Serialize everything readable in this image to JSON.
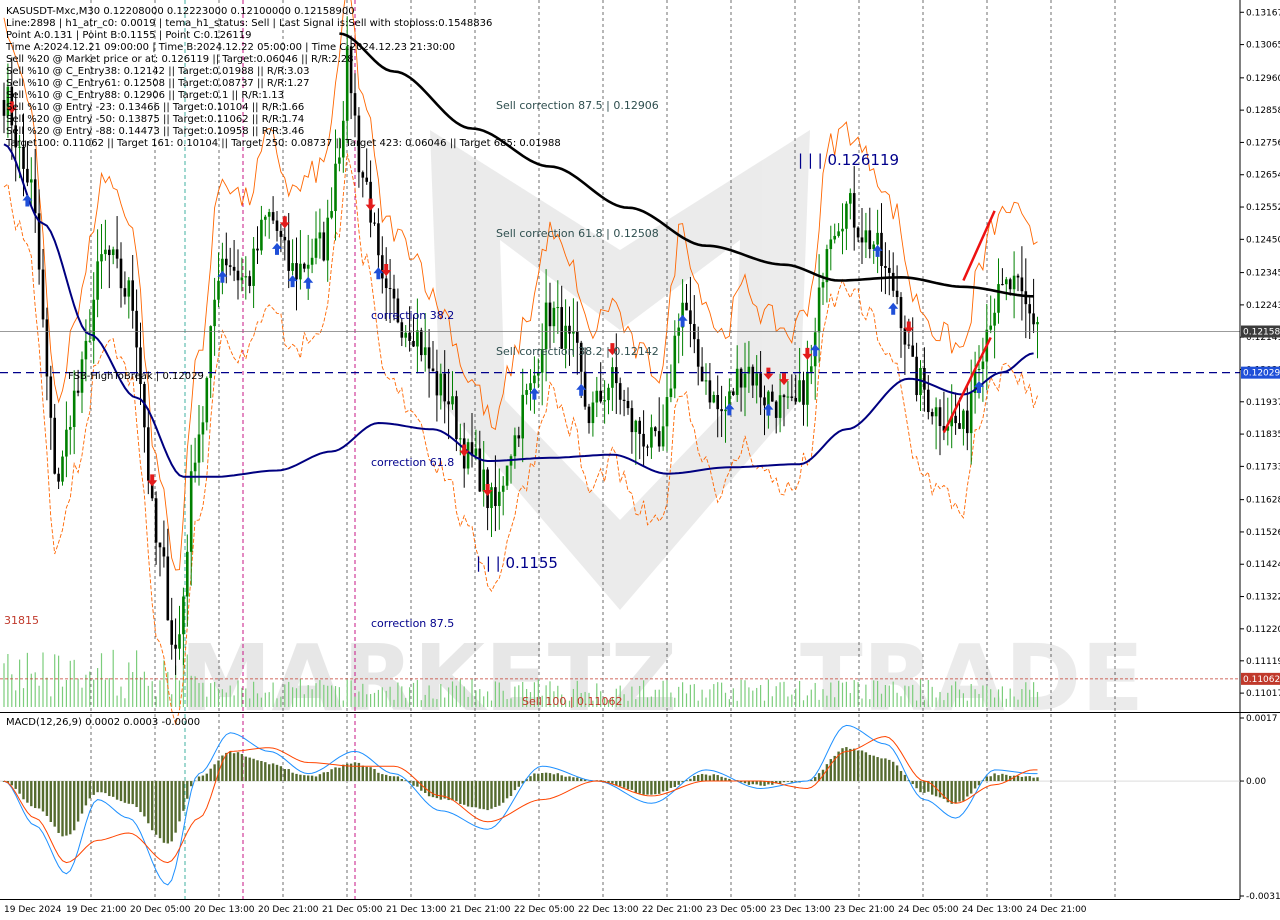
{
  "header": {
    "symbol_line": "KASUSDT-Mxc,M30  0.12208000 0.12223000 0.12100000 0.12158900",
    "info_lines": [
      "Line:2898 | h1_atr_c0: 0.0019 | tema_h1_status: Sell | Last Signal is:Sell with stoploss:0.1548836",
      "Point A:0.131 | Point B:0.1155 | Point C:0.126119",
      "Time A:2024.12.21 09:00:00 | Time B:2024.12.22 05:00:00 | Time C:2024.12.23 21:30:00",
      "Sell %20 @ Market price or at: 0.126119 || Target:0.06046 || R/R:2.28",
      "Sell %10 @ C_Entry38: 0.12142 || Target:0.01988 || R/R:3.03",
      "Sell %10 @ C_Entry61: 0.12508 || Target:0.08737 || R/R:1.27",
      "Sell %10 @ C_Entry88: 0.12906 || Target:0.1 || R/R:1.13",
      "Sell %10 @ Entry -23: 0.13466 || Target:0.10104 || R/R:1.66",
      "Sell %20 @ Entry -50: 0.13875 || Target:0.11062 || R/R:1.74",
      "Sell %20 @ Entry -88: 0.14473 || Target:0.10958 || R/R:3.46",
      "Target100: 0.11062 || Target 161: 0.10104 || Target 250: 0.08737 || Target 423: 0.06046 || Target 685: 0.01988"
    ]
  },
  "annotations": {
    "sell_correction_875": "Sell correction 87.5 | 0.12906",
    "sell_correction_618": "Sell correction 61.8 | 0.12508",
    "sell_correction_382": "Sell correction 38.2 | 0.12142",
    "correction_382": "correction 38.2",
    "correction_618": "correction 61.8",
    "correction_875": "correction 87.5",
    "point_c_label": "| | | 0.126119",
    "point_b_label": "| | | 0.1155",
    "sell_100": "Sell 100 | 0.11062",
    "fsb_label": "FSB-HighToBreak | 0.12029",
    "left_value": "31815"
  },
  "macd": {
    "label": "MACD(12,26,9) 0.0002 0.0003 -0.0000",
    "ticks": [
      {
        "value": 0.0017,
        "label": "0.0017"
      },
      {
        "value": 0.0,
        "label": "0.00"
      },
      {
        "value": -0.0031,
        "label": "-0.0031"
      }
    ]
  },
  "price_axis": {
    "min": 0.1097,
    "max": 0.1319,
    "ticks": [
      "0.13167",
      "0.13065",
      "0.12960",
      "0.12858",
      "0.12756",
      "0.12654",
      "0.12552",
      "0.12450",
      "0.12345",
      "0.12243",
      "0.12141",
      "0.12039",
      "0.11937",
      "0.11835",
      "0.11733",
      "0.11628",
      "0.11526",
      "0.11424",
      "0.11322",
      "0.11220",
      "0.11119",
      "0.11017"
    ],
    "tags": [
      {
        "value": 0.121589,
        "label": "0.12158",
        "color": "#3c3c3c"
      },
      {
        "value": 0.12029,
        "label": "0.12029",
        "color": "#1f4fd8"
      },
      {
        "value": 0.11062,
        "label": "0.11062",
        "color": "#c0392b"
      }
    ]
  },
  "time_axis": {
    "labels": [
      "19 Dec 2024",
      "19 Dec 21:00",
      "20 Dec 05:00",
      "20 Dec 13:00",
      "20 Dec 21:00",
      "21 Dec 05:00",
      "21 Dec 13:00",
      "21 Dec 21:00",
      "22 Dec 05:00",
      "22 Dec 13:00",
      "22 Dec 21:00",
      "23 Dec 05:00",
      "23 Dec 13:00",
      "23 Dec 21:00",
      "24 Dec 05:00",
      "24 Dec 13:00",
      "24 Dec 21:00"
    ]
  },
  "watermark": {
    "word1": "MARKETZ",
    "word2": "TRADE"
  },
  "colors": {
    "bull": "#008000",
    "bear": "#000000",
    "ma_long": "#000000",
    "ma_short": "#000080",
    "envelope": "#ff6600",
    "fsb_line": "#00008b",
    "sell_line": "#c0392b",
    "macd_hist": "#556b2f",
    "macd_line": "#1e90ff",
    "signal_line": "#ff4500",
    "volume": "#7ccd7c",
    "buy_arrow": "#1f4fd8",
    "sell_arrow": "#e31b1b"
  },
  "chart_data": {
    "type": "candlestick",
    "timeframe": "M30",
    "symbol": "KASUSDT-Mxc",
    "ylim": [
      0.1097,
      0.1319
    ],
    "macd_ylim": [
      -0.0031,
      0.0017
    ],
    "anchors": [
      {
        "i": 0,
        "p": 0.129
      },
      {
        "i": 6,
        "p": 0.1265
      },
      {
        "i": 14,
        "p": 0.117
      },
      {
        "i": 18,
        "p": 0.1195
      },
      {
        "i": 26,
        "p": 0.124
      },
      {
        "i": 32,
        "p": 0.1228
      },
      {
        "i": 40,
        "p": 0.1145
      },
      {
        "i": 44,
        "p": 0.1115
      },
      {
        "i": 50,
        "p": 0.1185
      },
      {
        "i": 56,
        "p": 0.124
      },
      {
        "i": 62,
        "p": 0.1232
      },
      {
        "i": 68,
        "p": 0.1252
      },
      {
        "i": 74,
        "p": 0.1235
      },
      {
        "i": 82,
        "p": 0.1243
      },
      {
        "i": 86,
        "p": 0.1275
      },
      {
        "i": 88,
        "p": 0.13
      },
      {
        "i": 92,
        "p": 0.1265
      },
      {
        "i": 98,
        "p": 0.1225
      },
      {
        "i": 104,
        "p": 0.1218
      },
      {
        "i": 112,
        "p": 0.1198
      },
      {
        "i": 120,
        "p": 0.1175
      },
      {
        "i": 126,
        "p": 0.116
      },
      {
        "i": 130,
        "p": 0.118
      },
      {
        "i": 134,
        "p": 0.1195
      },
      {
        "i": 140,
        "p": 0.1222
      },
      {
        "i": 146,
        "p": 0.121
      },
      {
        "i": 150,
        "p": 0.119
      },
      {
        "i": 156,
        "p": 0.12
      },
      {
        "i": 162,
        "p": 0.1185
      },
      {
        "i": 168,
        "p": 0.1178
      },
      {
        "i": 174,
        "p": 0.1225
      },
      {
        "i": 178,
        "p": 0.1205
      },
      {
        "i": 184,
        "p": 0.119
      },
      {
        "i": 190,
        "p": 0.1205
      },
      {
        "i": 196,
        "p": 0.1195
      },
      {
        "i": 202,
        "p": 0.119
      },
      {
        "i": 206,
        "p": 0.12
      },
      {
        "i": 212,
        "p": 0.125
      },
      {
        "i": 216,
        "p": 0.1255
      },
      {
        "i": 222,
        "p": 0.1245
      },
      {
        "i": 228,
        "p": 0.123
      },
      {
        "i": 234,
        "p": 0.12
      },
      {
        "i": 240,
        "p": 0.119
      },
      {
        "i": 246,
        "p": 0.1185
      },
      {
        "i": 250,
        "p": 0.121
      },
      {
        "i": 254,
        "p": 0.1225
      },
      {
        "i": 258,
        "p": 0.123
      },
      {
        "i": 264,
        "p": 0.122
      }
    ],
    "macd_anchors": [
      {
        "i": 0,
        "m": 0.0,
        "s": 0.0
      },
      {
        "i": 8,
        "m": -0.0012,
        "s": -0.001
      },
      {
        "i": 16,
        "m": -0.0025,
        "s": -0.0022
      },
      {
        "i": 24,
        "m": -0.0005,
        "s": -0.0016
      },
      {
        "i": 32,
        "m": -0.001,
        "s": -0.0014
      },
      {
        "i": 42,
        "m": -0.0028,
        "s": -0.0022
      },
      {
        "i": 50,
        "m": 0.0002,
        "s": -0.001
      },
      {
        "i": 58,
        "m": 0.0013,
        "s": 0.0008
      },
      {
        "i": 68,
        "m": 0.0008,
        "s": 0.0009
      },
      {
        "i": 78,
        "m": 0.0002,
        "s": 0.0005
      },
      {
        "i": 90,
        "m": 0.0008,
        "s": 0.0004
      },
      {
        "i": 100,
        "m": 0.0002,
        "s": 0.0004
      },
      {
        "i": 112,
        "m": -0.0008,
        "s": -0.0004
      },
      {
        "i": 124,
        "m": -0.0013,
        "s": -0.0011
      },
      {
        "i": 138,
        "m": 0.0004,
        "s": -0.0005
      },
      {
        "i": 152,
        "m": 0.0,
        "s": 0.0
      },
      {
        "i": 166,
        "m": -0.0006,
        "s": -0.0004
      },
      {
        "i": 180,
        "m": 0.0003,
        "s": 0.0
      },
      {
        "i": 194,
        "m": -0.0002,
        "s": 0.0
      },
      {
        "i": 206,
        "m": 0.0,
        "s": -0.0002
      },
      {
        "i": 216,
        "m": 0.0015,
        "s": 0.0008
      },
      {
        "i": 226,
        "m": 0.001,
        "s": 0.0012
      },
      {
        "i": 236,
        "m": -0.0005,
        "s": 0.0
      },
      {
        "i": 244,
        "m": -0.001,
        "s": -0.0006
      },
      {
        "i": 254,
        "m": 0.0003,
        "s": -0.0001
      },
      {
        "i": 264,
        "m": 0.0002,
        "s": 0.0003
      }
    ],
    "ma_long": [
      {
        "i": 86,
        "p": 0.131
      },
      {
        "i": 100,
        "p": 0.1298
      },
      {
        "i": 120,
        "p": 0.128
      },
      {
        "i": 140,
        "p": 0.1268
      },
      {
        "i": 160,
        "p": 0.1255
      },
      {
        "i": 180,
        "p": 0.1243
      },
      {
        "i": 200,
        "p": 0.1237
      },
      {
        "i": 214,
        "p": 0.1232
      },
      {
        "i": 230,
        "p": 0.1233
      },
      {
        "i": 246,
        "p": 0.123
      },
      {
        "i": 264,
        "p": 0.1227
      }
    ],
    "ma_short": [
      {
        "i": 0,
        "p": 0.1275
      },
      {
        "i": 10,
        "p": 0.125
      },
      {
        "i": 22,
        "p": 0.1215
      },
      {
        "i": 34,
        "p": 0.1195
      },
      {
        "i": 46,
        "p": 0.117
      },
      {
        "i": 54,
        "p": 0.117
      },
      {
        "i": 70,
        "p": 0.1172
      },
      {
        "i": 84,
        "p": 0.1178
      },
      {
        "i": 96,
        "p": 0.1187
      },
      {
        "i": 110,
        "p": 0.1185
      },
      {
        "i": 124,
        "p": 0.1175
      },
      {
        "i": 140,
        "p": 0.1176
      },
      {
        "i": 156,
        "p": 0.1177
      },
      {
        "i": 170,
        "p": 0.1171
      },
      {
        "i": 186,
        "p": 0.1173
      },
      {
        "i": 204,
        "p": 0.1174
      },
      {
        "i": 216,
        "p": 0.1185
      },
      {
        "i": 232,
        "p": 0.1201
      },
      {
        "i": 246,
        "p": 0.1196
      },
      {
        "i": 256,
        "p": 0.1203
      },
      {
        "i": 264,
        "p": 0.1209
      }
    ],
    "buy_signals": [
      6,
      56,
      70,
      74,
      78,
      96,
      136,
      148,
      174,
      186,
      196,
      208,
      224,
      228,
      250
    ],
    "sell_signals": [
      2,
      38,
      72,
      94,
      98,
      118,
      124,
      156,
      196,
      200,
      206,
      232
    ]
  }
}
